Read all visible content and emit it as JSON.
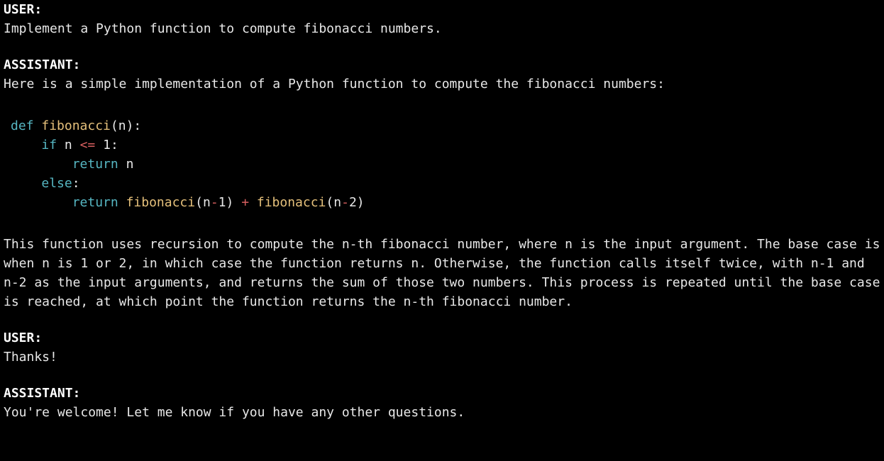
{
  "colors": {
    "bg": "#000000",
    "fg": "#f0f0f0",
    "keyword": "#56b6c2",
    "funcname": "#e5c07b",
    "operator": "#d75f5f"
  },
  "conversation": [
    {
      "role_label": "USER:",
      "text": "Implement a Python function to compute fibonacci numbers."
    },
    {
      "role_label": "ASSISTANT:",
      "text_before_code": "Here is a simple implementation of a Python function to compute the fibonacci numbers:",
      "code": {
        "language": "python",
        "tokens": [
          [
            "kw",
            "def "
          ],
          [
            "fn",
            "fibonacci"
          ],
          [
            "pun",
            "(n):"
          ],
          [
            "nl",
            ""
          ],
          [
            "pun",
            "    "
          ],
          [
            "kw",
            "if"
          ],
          [
            "pun",
            " n "
          ],
          [
            "op",
            "<="
          ],
          [
            "pun",
            " "
          ],
          [
            "num",
            "1"
          ],
          [
            "pun",
            ":"
          ],
          [
            "nl",
            ""
          ],
          [
            "pun",
            "        "
          ],
          [
            "kw",
            "return"
          ],
          [
            "pun",
            " n"
          ],
          [
            "nl",
            ""
          ],
          [
            "pun",
            "    "
          ],
          [
            "kw",
            "else"
          ],
          [
            "pun",
            ":"
          ],
          [
            "nl",
            ""
          ],
          [
            "pun",
            "        "
          ],
          [
            "kw",
            "return"
          ],
          [
            "pun",
            " "
          ],
          [
            "fn",
            "fibonacci"
          ],
          [
            "pun",
            "(n"
          ],
          [
            "op",
            "-"
          ],
          [
            "num",
            "1"
          ],
          [
            "pun",
            ") "
          ],
          [
            "op",
            "+"
          ],
          [
            "pun",
            " "
          ],
          [
            "fn",
            "fibonacci"
          ],
          [
            "pun",
            "(n"
          ],
          [
            "op",
            "-"
          ],
          [
            "num",
            "2"
          ],
          [
            "pun",
            ")"
          ]
        ]
      },
      "text_after_code": "This function uses recursion to compute the n-th fibonacci number, where n is the input argument. The base case is when n is 1 or 2, in which case the function returns n. Otherwise, the function calls itself twice, with n-1 and n-2 as the input arguments, and returns the sum of those two numbers. This process is repeated until the base case is reached, at which point the function returns the n-th fibonacci number."
    },
    {
      "role_label": "USER:",
      "text": "Thanks!"
    },
    {
      "role_label": "ASSISTANT:",
      "text": "You're welcome! Let me know if you have any other questions."
    }
  ]
}
